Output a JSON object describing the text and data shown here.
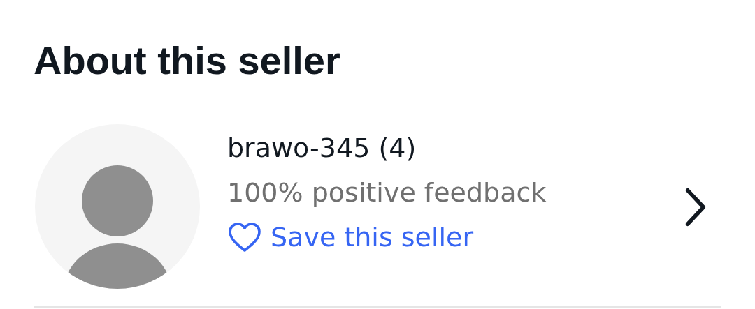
{
  "section": {
    "title": "About this seller"
  },
  "seller": {
    "name": "brawo-345 (4)",
    "feedback": "100% positive feedback",
    "save": {
      "label": "Save this seller",
      "saved": false
    }
  }
}
